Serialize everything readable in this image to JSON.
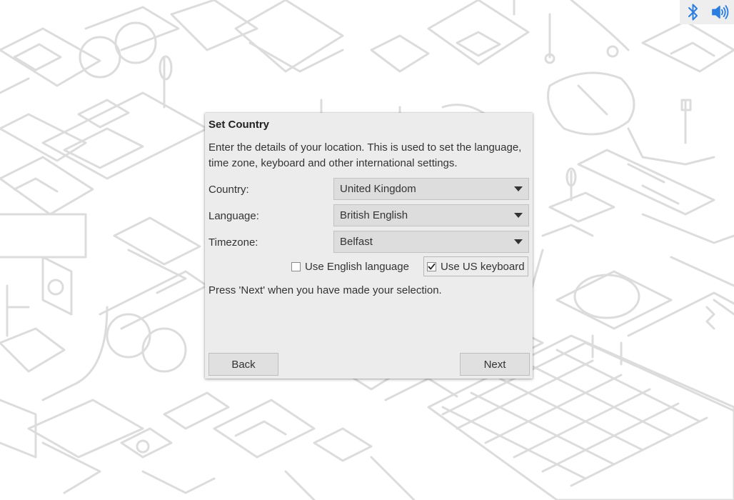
{
  "tray": {
    "bluetooth_icon": "bluetooth-icon",
    "volume_icon": "volume-icon",
    "accent_color": "#2a7de1"
  },
  "dialog": {
    "title": "Set Country",
    "intro": "Enter the details of your location. This is used to set the language, time zone, keyboard and other international settings.",
    "country": {
      "label": "Country:",
      "value": "United Kingdom"
    },
    "language": {
      "label": "Language:",
      "value": "British English"
    },
    "timezone": {
      "label": "Timezone:",
      "value": "Belfast"
    },
    "use_english": {
      "label": "Use English language",
      "checked": false
    },
    "use_us_keyboard": {
      "label": "Use US keyboard",
      "checked": true
    },
    "press_next": "Press 'Next' when you have made your selection.",
    "back_label": "Back",
    "next_label": "Next"
  }
}
